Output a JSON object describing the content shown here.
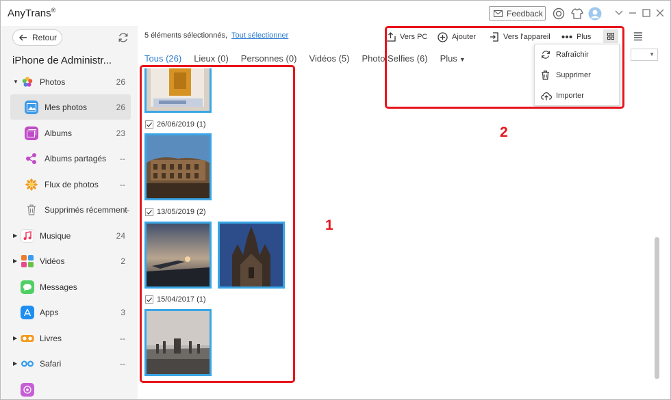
{
  "app": {
    "title": "AnyTrans",
    "registered_mark": "®",
    "feedback_label": "Feedback"
  },
  "sidebar": {
    "back_label": "Retour",
    "device_name": "iPhone de Administr...",
    "items": [
      {
        "label": "Photos",
        "count": "26",
        "icon": "photos-icon",
        "caret": "▼"
      },
      {
        "label": "Mes photos",
        "count": "26",
        "icon": "my-photos-icon"
      },
      {
        "label": "Albums",
        "count": "23",
        "icon": "albums-icon"
      },
      {
        "label": "Albums partagés",
        "count": "--",
        "icon": "shared-albums-icon"
      },
      {
        "label": "Flux de photos",
        "count": "--",
        "icon": "photo-stream-icon"
      },
      {
        "label": "Supprimés récemment",
        "count": "--",
        "icon": "trash-icon"
      },
      {
        "label": "Musique",
        "count": "24",
        "icon": "music-icon",
        "caret": "▶"
      },
      {
        "label": "Vidéos",
        "count": "2",
        "icon": "videos-icon",
        "caret": "▶"
      },
      {
        "label": "Messages",
        "count": "",
        "icon": "messages-icon"
      },
      {
        "label": "Apps",
        "count": "3",
        "icon": "apps-icon"
      },
      {
        "label": "Livres",
        "count": "--",
        "icon": "books-icon",
        "caret": "▶"
      },
      {
        "label": "Safari",
        "count": "--",
        "icon": "safari-icon",
        "caret": "▶"
      }
    ]
  },
  "main": {
    "selection_text": "5 éléments sélectionnés,",
    "select_all_link": "Tout sélectionner",
    "toolbar": {
      "to_pc": "Vers PC",
      "add": "Ajouter",
      "to_device": "Vers l'appareil",
      "more": "Plus"
    },
    "tabs": [
      {
        "label": "Tous (26)",
        "active": true
      },
      {
        "label": "Lieux (0)"
      },
      {
        "label": "Personnes (0)"
      },
      {
        "label": "Vidéos (5)"
      },
      {
        "label": "Photo Selfies (6)"
      },
      {
        "label": "Plus",
        "caret": "▼"
      }
    ],
    "groups": [
      {
        "date": "26/06/2019 (1)"
      },
      {
        "date": "13/05/2019 (2)"
      },
      {
        "date": "15/04/2017 (1)"
      }
    ],
    "dropdown": {
      "refresh": "Rafraîchir",
      "delete": "Supprimer",
      "import": "Importer"
    }
  },
  "annotations": {
    "box1_number": "1",
    "box2_number": "2",
    "color": "#e8141c"
  },
  "colors": {
    "accent": "#2b7bd1",
    "selection_border": "#3aa6e6",
    "sidebar_bg": "#f4f4f4"
  }
}
